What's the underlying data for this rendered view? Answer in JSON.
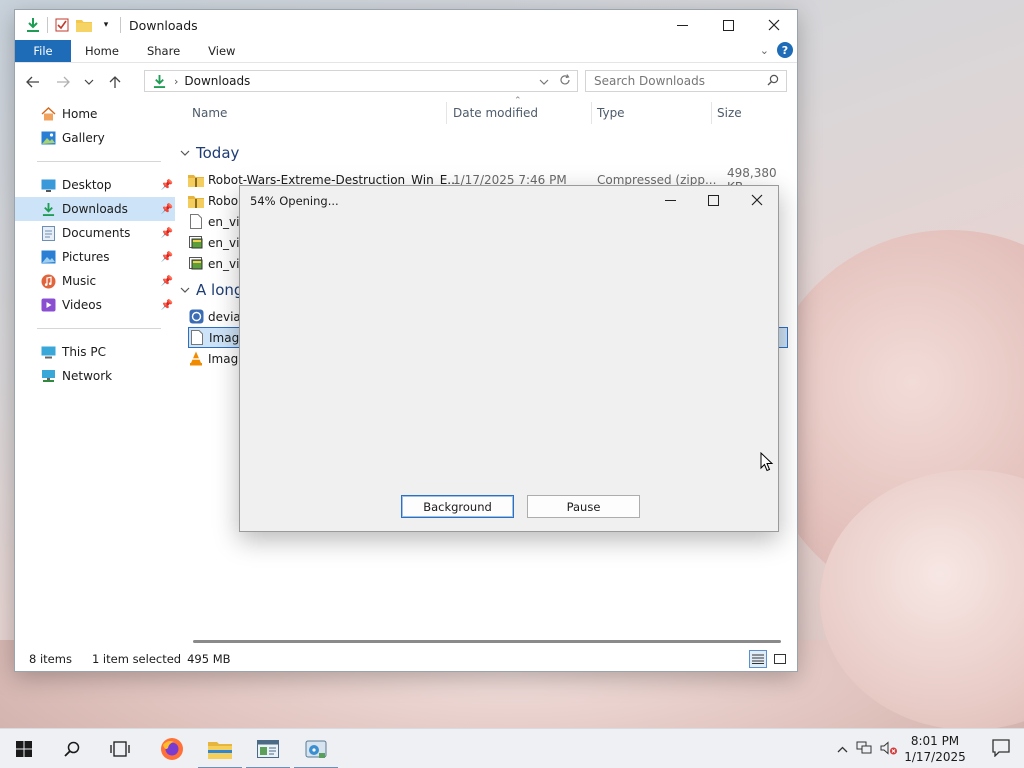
{
  "explorer": {
    "title": "Downloads",
    "ribbon_tabs": [
      "File",
      "Home",
      "Share",
      "View"
    ],
    "help_label": "?",
    "breadcrumb": "Downloads",
    "search_placeholder": "Search Downloads",
    "sidebar": {
      "quick": [
        {
          "label": "Home",
          "icon": "home-icon"
        },
        {
          "label": "Gallery",
          "icon": "gallery-icon"
        }
      ],
      "pinned": [
        {
          "label": "Desktop",
          "icon": "desktop-icon"
        },
        {
          "label": "Downloads",
          "icon": "download-icon"
        },
        {
          "label": "Documents",
          "icon": "documents-icon"
        },
        {
          "label": "Pictures",
          "icon": "pictures-icon"
        },
        {
          "label": "Music",
          "icon": "music-icon"
        },
        {
          "label": "Videos",
          "icon": "videos-icon"
        }
      ],
      "computer": [
        {
          "label": "This PC",
          "icon": "computer-icon"
        },
        {
          "label": "Network",
          "icon": "network-icon"
        }
      ]
    },
    "columns": {
      "name": "Name",
      "date": "Date modified",
      "type": "Type",
      "size": "Size"
    },
    "groups": {
      "today": "Today",
      "older": "A long"
    },
    "files": [
      {
        "name": "Robot-Wars-Extreme-Destruction_Win_E...",
        "date": "1/17/2025 7:46 PM",
        "type": "Compressed (zipp...",
        "size": "498,380 KB",
        "icon": "zip-folder-icon"
      },
      {
        "name": "Robo",
        "icon": "zip-folder-icon"
      },
      {
        "name": "en_vi",
        "icon": "file-icon"
      },
      {
        "name": "en_vi",
        "icon": "exe-file-icon"
      },
      {
        "name": "en_vi",
        "icon": "exe-file-icon"
      },
      {
        "name": "devia",
        "icon": "app-icon"
      },
      {
        "name": "Imag",
        "icon": "file-icon",
        "selected": true
      },
      {
        "name": "Imag",
        "icon": "vlc-icon"
      }
    ],
    "status": {
      "items": "8 items",
      "selected": "1 item selected",
      "size": "495 MB"
    }
  },
  "dialog": {
    "title": "54% Opening...",
    "buttons": {
      "background": "Background",
      "pause": "Pause"
    }
  },
  "taskbar": {
    "time": "8:01 PM",
    "date": "1/17/2025"
  },
  "colors": {
    "accent": "#1e6bb8",
    "selection": "#cde3f7",
    "download_green": "#1f9d55"
  }
}
